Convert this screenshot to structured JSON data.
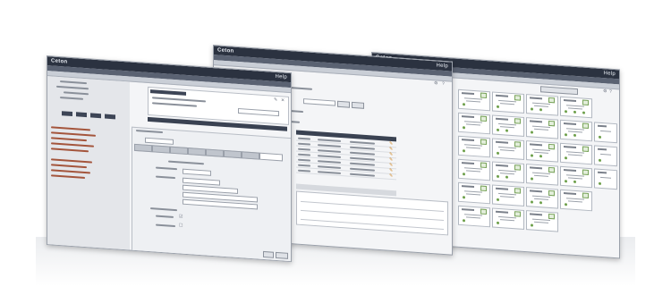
{
  "brand": "Ceton",
  "windows": [
    {
      "id": "left",
      "title": "Ceton",
      "right_label": "Help"
    },
    {
      "id": "middle",
      "title": "Ceton",
      "right_label": "Help"
    },
    {
      "id": "right",
      "title": "Ceton",
      "right_label": "Help"
    }
  ],
  "colors": {
    "titlebar": "#2b3240",
    "accent_dark": "#3d4556",
    "status_green": "#6ea04b"
  },
  "icons": [
    "gear-icon",
    "help-icon",
    "close-icon",
    "checkbox-icon",
    "edit-icon"
  ]
}
